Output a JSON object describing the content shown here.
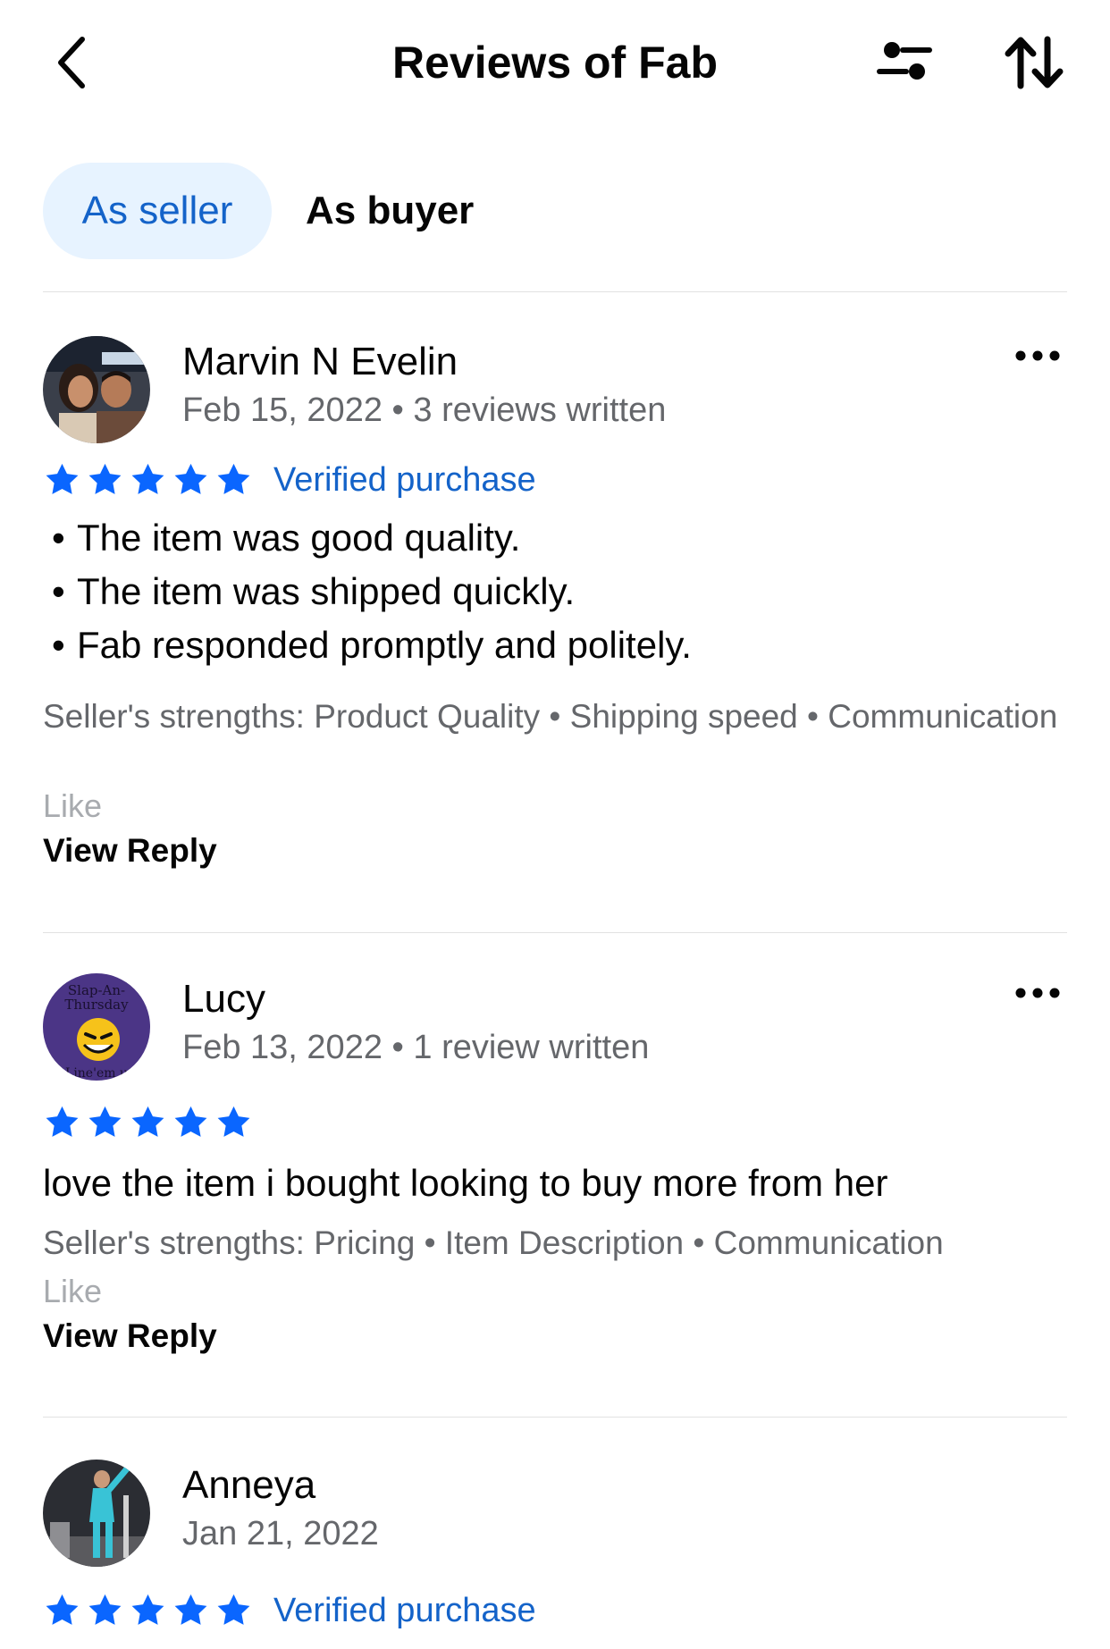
{
  "header": {
    "title": "Reviews of Fab"
  },
  "tabs": {
    "seller": "As seller",
    "buyer": "As buyer"
  },
  "colors": {
    "accent": "#1463C9",
    "star": "#0A66FF",
    "tab_active_bg": "#E7F3FF",
    "muted": "#65676B"
  },
  "reviews": [
    {
      "name": "Marvin N Evelin",
      "meta": "Feb 15, 2022 • 3 reviews written",
      "rating": 5,
      "verified": "Verified purchase",
      "bullets": [
        "The item was good quality.",
        "The item was shipped quickly.",
        "Fab responded promptly and politely."
      ],
      "strengths": "Seller's strengths: Product Quality • Shipping speed • Communication",
      "like": "Like",
      "view_reply": "View Reply"
    },
    {
      "name": "Lucy",
      "meta": "Feb 13, 2022 • 1 review written",
      "rating": 5,
      "text": "love the item i bought looking to buy more from her",
      "strengths": "Seller's strengths: Pricing • Item Description • Communication",
      "like": "Like",
      "view_reply": "View Reply",
      "avatar_text": [
        "Slap-An-",
        "Thursday",
        "Line'em u"
      ]
    },
    {
      "name": "Anneya",
      "meta": "Jan 21, 2022",
      "rating": 5,
      "verified": "Verified purchase"
    }
  ]
}
